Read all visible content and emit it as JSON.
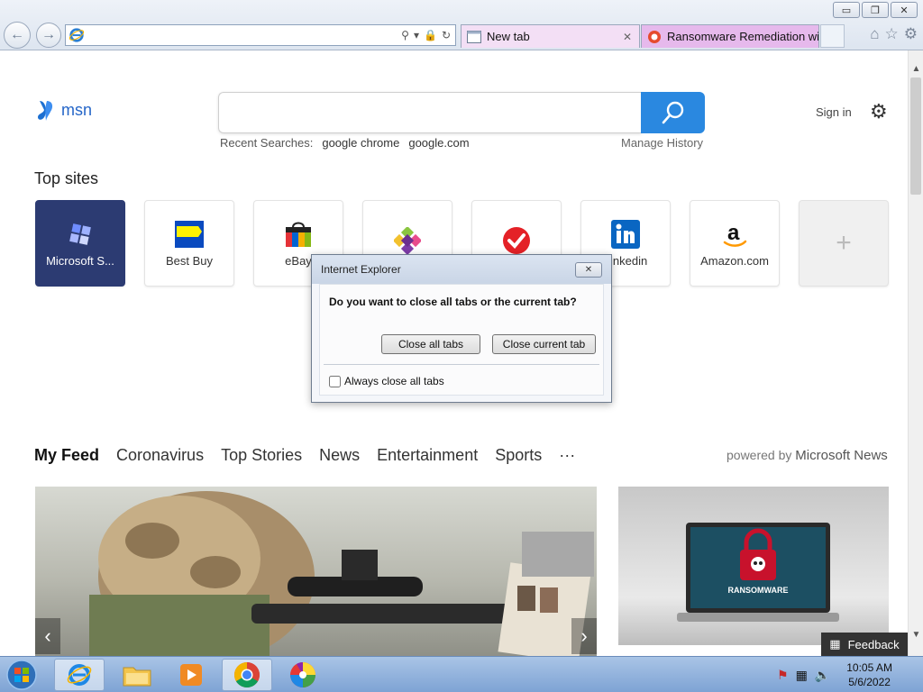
{
  "window": {
    "minimize": "▭",
    "restore": "❐",
    "close": "✕"
  },
  "address_bar": {
    "value": "",
    "placeholder": ""
  },
  "tabs": [
    {
      "label": "New tab",
      "close": "✕"
    },
    {
      "label": "Ransomware Remediation wit..."
    }
  ],
  "msn": {
    "logo_text": "msn",
    "search_placeholder": "",
    "recent_searches_label": "Recent Searches:",
    "recent_searches": [
      "google chrome",
      "google.com"
    ],
    "manage_history": "Manage History",
    "sign_in": "Sign in"
  },
  "top_sites": {
    "title": "Top sites",
    "items": [
      {
        "label": "Microsoft S..."
      },
      {
        "label": "Best Buy"
      },
      {
        "label": "eBay"
      },
      {
        "label": ""
      },
      {
        "label": ""
      },
      {
        "label": "Linkedin"
      },
      {
        "label": "Amazon.com"
      }
    ]
  },
  "feed": {
    "tabs": [
      "My Feed",
      "Coronavirus",
      "Top Stories",
      "News",
      "Entertainment",
      "Sports",
      "···"
    ],
    "powered_by_prefix": "powered by",
    "powered_by_brand": "Microsoft News",
    "feedback": "Feedback",
    "side_card_overlay": "RANSOMWARE"
  },
  "dialog": {
    "title": "Internet Explorer",
    "question": "Do you want to close all tabs or the current tab?",
    "close_all": "Close all tabs",
    "close_current": "Close current tab",
    "always_close_all": "Always close all tabs"
  },
  "taskbar": {
    "time": "10:05 AM",
    "date": "5/6/2022"
  }
}
